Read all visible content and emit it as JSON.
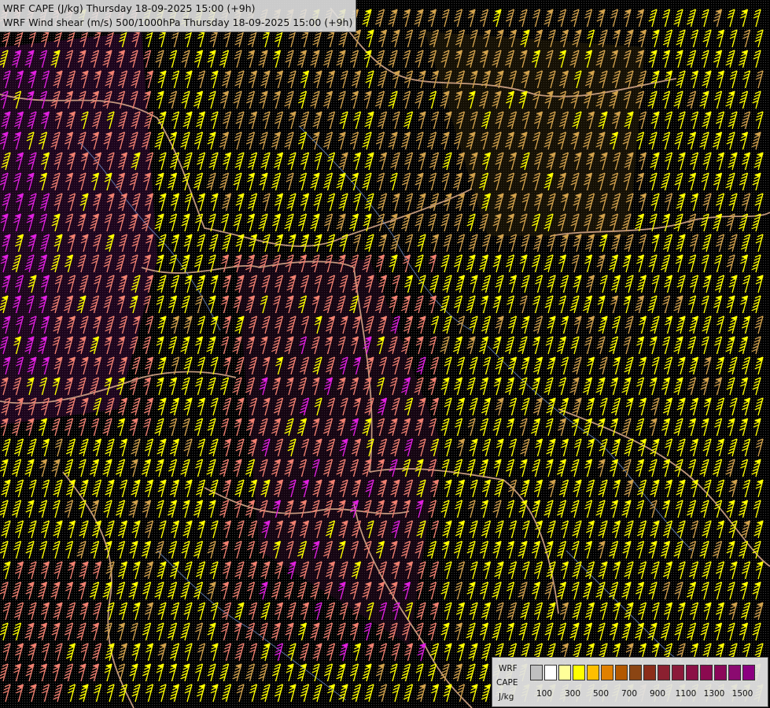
{
  "titles": {
    "line1": "WRF CAPE (J/kg) Thursday 18-09-2025 15:00 (+9h)",
    "line2": "WRF Wind shear (m/s) 500/1000hPa Thursday 18-09-2025 15:00 (+9h)"
  },
  "legend": {
    "label_model": "WRF",
    "label_field": "CAPE",
    "label_unit": "J/kg",
    "ticks": [
      "100",
      "300",
      "500",
      "700",
      "900",
      "1100",
      "1300",
      "1500"
    ],
    "swatch_colors": [
      "#bfbfbf",
      "#ffffff",
      "#ffff99",
      "#ffff00",
      "#ffbf00",
      "#e08000",
      "#b35900",
      "#8b4513",
      "#8b2d1a",
      "#8b2030",
      "#8b1a3a",
      "#8b1045",
      "#8b0a50",
      "#8b085a",
      "#8b0a70",
      "#8b0080"
    ]
  },
  "colors": {
    "background": "#000000",
    "barb_yellow": "#ffff00",
    "barb_tan": "#d2a24c",
    "barb_salmon": "#f08070",
    "barb_magenta": "#e020e0",
    "border": "#e0b090",
    "coast": "#6b8cc7"
  }
}
